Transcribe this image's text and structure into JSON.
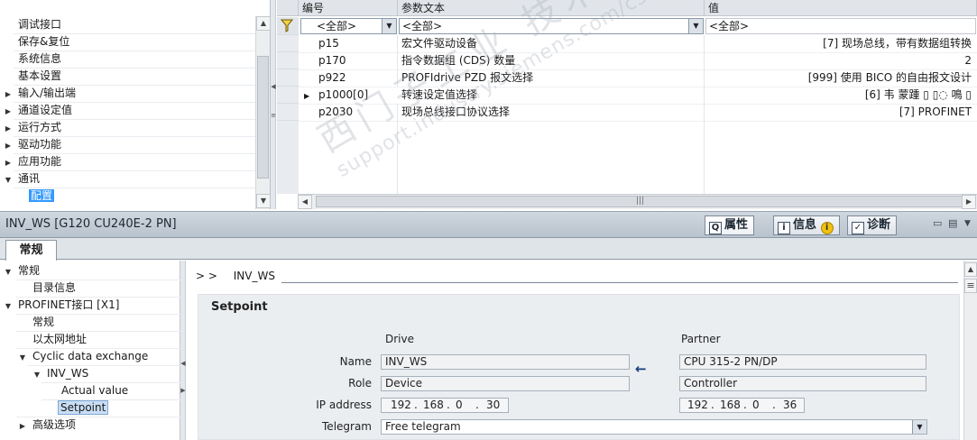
{
  "top_tree": {
    "items": [
      {
        "label": "调试接口",
        "expander": ""
      },
      {
        "label": "保存&复位",
        "expander": ""
      },
      {
        "label": "系统信息",
        "expander": ""
      },
      {
        "label": "基本设置",
        "expander": ""
      },
      {
        "label": "输入/输出端",
        "expander": "▶"
      },
      {
        "label": "通道设定值",
        "expander": "▶"
      },
      {
        "label": "运行方式",
        "expander": "▶"
      },
      {
        "label": "驱动功能",
        "expander": "▶"
      },
      {
        "label": "应用功能",
        "expander": "▶"
      },
      {
        "label": "通讯",
        "expander": "▼"
      },
      {
        "label": "配置",
        "expander": ""
      }
    ]
  },
  "param_table": {
    "headers": {
      "number": "编号",
      "text": "参数文本",
      "value": "值"
    },
    "filters": {
      "number": "<全部>",
      "text": "<全部>",
      "value": "<全部>"
    },
    "rows": [
      {
        "number": "p15",
        "text": "宏文件驱动设备",
        "value": "[7] 现场总线，带有数据组转换",
        "expander": ""
      },
      {
        "number": "p170",
        "text": "指令数据组 (CDS) 数量",
        "value": "2",
        "expander": ""
      },
      {
        "number": "p922",
        "text": "PROFIdrive PZD 报文选择",
        "value": "[999] 使用 BICO 的自由报文设计",
        "expander": ""
      },
      {
        "number": "p1000[0]",
        "text": "转速设定值选择",
        "value": "[6] 韦 蒙踵 ▯ ▯◌ 鳴 ▯",
        "expander": "▶"
      },
      {
        "number": "p2030",
        "text": "现场总线接口协议选择",
        "value": "[7] PROFINET",
        "expander": ""
      }
    ]
  },
  "inspector": {
    "title": "INV_WS [G120 CU240E-2 PN]",
    "tabs": {
      "properties": "属性",
      "info": "信息",
      "diagnostics": "诊断"
    },
    "subtab": "常规",
    "tree": [
      {
        "label": "常规",
        "expander": "▼"
      },
      {
        "label": "目录信息",
        "expander": ""
      },
      {
        "label": "PROFINET接口 [X1]",
        "expander": "▼"
      },
      {
        "label": "常规",
        "expander": ""
      },
      {
        "label": "以太网地址",
        "expander": ""
      },
      {
        "label": "Cyclic data exchange",
        "expander": "▼"
      },
      {
        "label": "INV_WS",
        "expander": "▼"
      },
      {
        "label": "Actual value",
        "expander": ""
      },
      {
        "label": "Setpoint",
        "expander": ""
      },
      {
        "label": "高级选项",
        "expander": "▶"
      }
    ],
    "breadcrumb": {
      "sep": "> >",
      "device": "INV_WS"
    },
    "panel": {
      "title": "Setpoint",
      "drive_header": "Drive",
      "partner_header": "Partner",
      "labels": {
        "name": "Name",
        "role": "Role",
        "ip": "IP address",
        "telegram": "Telegram"
      },
      "drive": {
        "name": "INV_WS",
        "role": "Device",
        "ip": [
          "192",
          "168",
          "0",
          "30"
        ]
      },
      "partner": {
        "name": "CPU 315-2 PN/DP",
        "role": "Controller",
        "ip": [
          "192",
          "168",
          "0",
          "36"
        ]
      },
      "telegram": "Free telegram"
    }
  },
  "watermark": {
    "line1": "西门子工业  技术论坛",
    "line2": "support.industry.siemens.com/cs"
  }
}
